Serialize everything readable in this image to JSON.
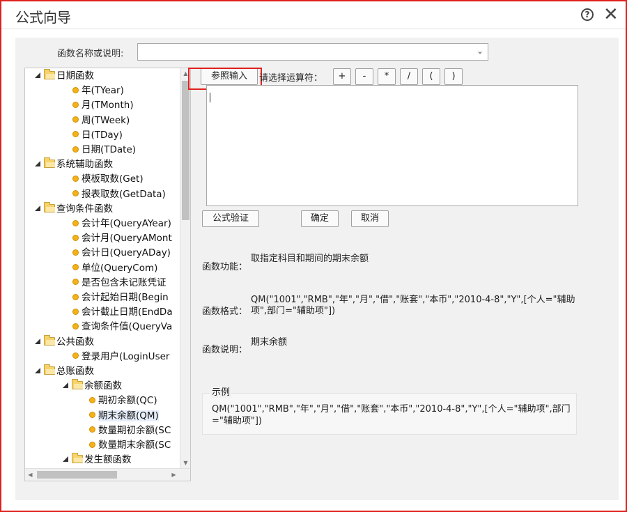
{
  "window": {
    "title": "公式向导"
  },
  "search": {
    "label": "函数名称或说明:",
    "value": ""
  },
  "tree": {
    "items": [
      {
        "label": "日期函数",
        "type": "folder",
        "level": 0
      },
      {
        "label": "年(TYear)",
        "type": "leaf",
        "level": 1
      },
      {
        "label": "月(TMonth)",
        "type": "leaf",
        "level": 1
      },
      {
        "label": "周(TWeek)",
        "type": "leaf",
        "level": 1
      },
      {
        "label": "日(TDay)",
        "type": "leaf",
        "level": 1
      },
      {
        "label": "日期(TDate)",
        "type": "leaf",
        "level": 1
      },
      {
        "label": "系统辅助函数",
        "type": "folder",
        "level": 0
      },
      {
        "label": "模板取数(Get)",
        "type": "leaf",
        "level": 1
      },
      {
        "label": "报表取数(GetData)",
        "type": "leaf",
        "level": 1
      },
      {
        "label": "查询条件函数",
        "type": "folder",
        "level": 0
      },
      {
        "label": "会计年(QueryAYear)",
        "type": "leaf",
        "level": 1
      },
      {
        "label": "会计月(QueryAMont",
        "type": "leaf",
        "level": 1
      },
      {
        "label": "会计日(QueryADay)",
        "type": "leaf",
        "level": 1
      },
      {
        "label": "单位(QueryCom)",
        "type": "leaf",
        "level": 1
      },
      {
        "label": "是否包含未记账凭证",
        "type": "leaf",
        "level": 1
      },
      {
        "label": "会计起始日期(Begin",
        "type": "leaf",
        "level": 1
      },
      {
        "label": "会计截止日期(EndDa",
        "type": "leaf",
        "level": 1
      },
      {
        "label": "查询条件值(QueryVa",
        "type": "leaf",
        "level": 1
      },
      {
        "label": "公共函数",
        "type": "folder",
        "level": 0
      },
      {
        "label": "登录用户(LoginUser",
        "type": "leaf",
        "level": 1
      },
      {
        "label": "总账函数",
        "type": "folder",
        "level": 0
      },
      {
        "label": "余额函数",
        "type": "folder",
        "level": 1
      },
      {
        "label": "期初余额(QC)",
        "type": "leaf",
        "level": 2
      },
      {
        "label": "期末余额(QM)",
        "type": "leaf",
        "level": 2,
        "selected": true
      },
      {
        "label": "数量期初余额(SC",
        "type": "leaf",
        "level": 2
      },
      {
        "label": "数量期末余额(SC",
        "type": "leaf",
        "level": 2
      },
      {
        "label": "发生额函数",
        "type": "folder",
        "level": 1
      }
    ]
  },
  "toolbar": {
    "ref_input_label": "参照输入",
    "operator_label": "请选择运算符：",
    "operators": [
      "+",
      "-",
      "*",
      "/",
      "(",
      ")"
    ]
  },
  "formula": {
    "value": ""
  },
  "actions": {
    "verify_label": "公式验证",
    "ok_label": "确定",
    "cancel_label": "取消"
  },
  "info": {
    "function_label": "函数功能：",
    "function_value": "取指定科目和期间的期末余额",
    "format_label": "函数格式：",
    "format_value": "QM(\"1001\",\"RMB\",\"年\",\"月\",\"借\",\"账套\",\"本币\",\"2010-4-8\",\"Y\",[个人=\"辅助项\",部门=\"辅助项\"])",
    "desc_label": "函数说明：",
    "desc_value": "期末余额"
  },
  "example": {
    "legend": "示例",
    "text": "QM(\"1001\",\"RMB\",\"年\",\"月\",\"借\",\"账套\",\"本币\",\"2010-4-8\",\"Y\",[个人=\"辅助项\",部门=\"辅助项\"])"
  },
  "colors": {
    "highlight": "#e0201c",
    "folder": "#f7d36b",
    "leaf_dot": "#f3b21a"
  }
}
